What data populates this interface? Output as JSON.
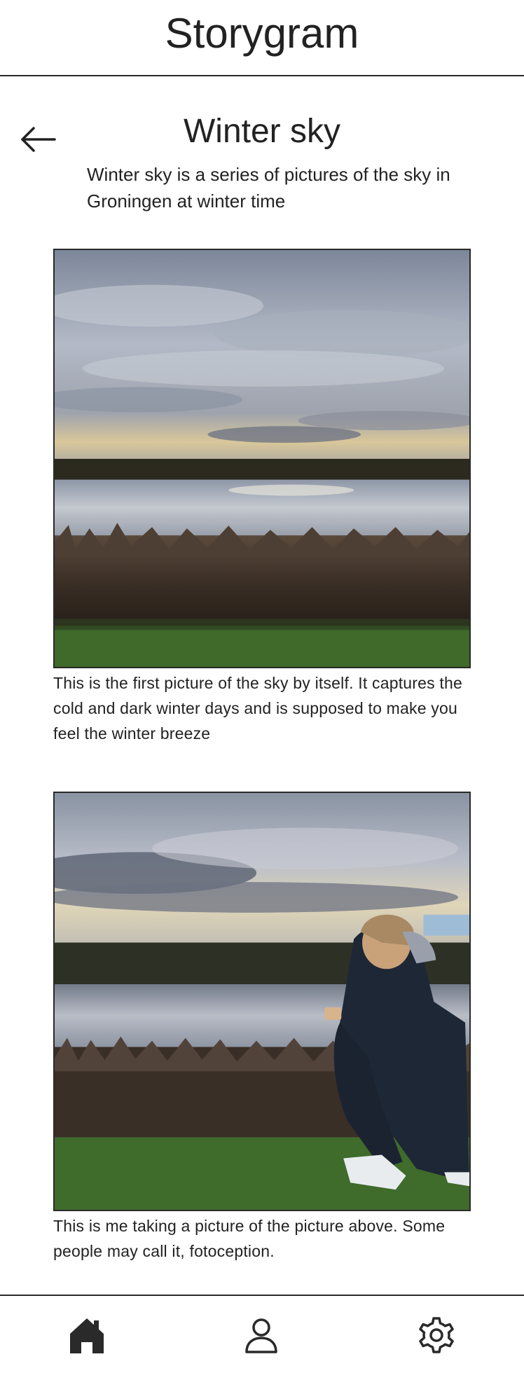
{
  "header": {
    "app_title": "Storygram"
  },
  "story": {
    "title": "Winter sky",
    "description": "Winter sky is a series of pictures of the sky in Groningen at winter time",
    "back_icon": "arrow-left-icon"
  },
  "posts": [
    {
      "image_subject": "winter sky over a lake with reeds",
      "caption": "This is the first picture of the sky by itself. It captures the cold and dark winter days and is supposed to make you feel the winter breeze"
    },
    {
      "image_subject": "person crouching by the lake photographing the sky",
      "caption": "This is me taking a picture of the picture above. Some people may call it, fotoception."
    }
  ],
  "bottom_nav": {
    "items": [
      {
        "icon": "home-icon",
        "selected": true
      },
      {
        "icon": "profile-icon",
        "selected": false
      },
      {
        "icon": "settings-icon",
        "selected": false
      }
    ]
  },
  "colors": {
    "text": "#222222",
    "divider": "#2a2a2a",
    "background": "#ffffff"
  }
}
